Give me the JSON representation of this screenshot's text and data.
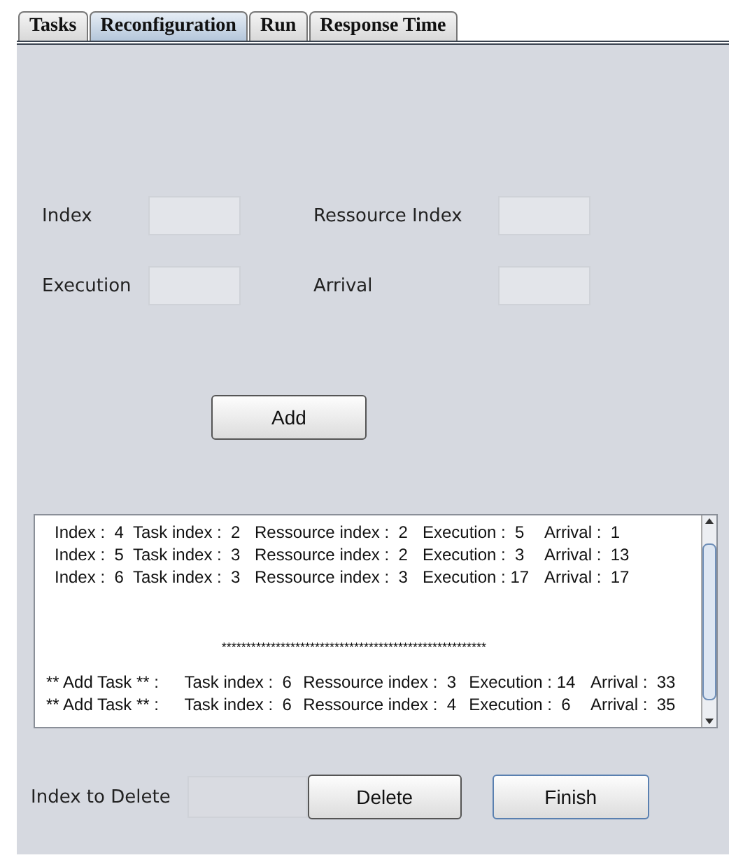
{
  "tabs": [
    {
      "label": "Tasks",
      "selected": false
    },
    {
      "label": "Reconfiguration",
      "selected": true
    },
    {
      "label": "Run",
      "selected": false
    },
    {
      "label": "Response Time",
      "selected": false
    }
  ],
  "form": {
    "fields": [
      {
        "label": "Index"
      },
      {
        "label": "Ressource Index"
      },
      {
        "label": "Execution"
      },
      {
        "label": "Arrival"
      }
    ],
    "add_button": "Add"
  },
  "log": [
    {
      "kind": "entry",
      "parts": [
        "Index :  4",
        "Task index :  2",
        "Ressource index :  2",
        "Execution :  5",
        "Arrival :  1"
      ]
    },
    {
      "kind": "entry",
      "parts": [
        "Index :  5",
        "Task index :  3",
        "Ressource index :  2",
        "Execution :  3",
        "Arrival :  13"
      ]
    },
    {
      "kind": "entry",
      "parts": [
        "Index :  6",
        "Task index :  3",
        "Ressource index :  3",
        "Execution : 17",
        "Arrival :  17"
      ]
    },
    {
      "kind": "separator",
      "parts": [
        "******************************************************"
      ]
    },
    {
      "kind": "add",
      "parts": [
        "** Add Task ** :",
        "Task index :  6",
        "Ressource index :  3",
        "Execution : 14",
        "Arrival :  33"
      ]
    },
    {
      "kind": "add",
      "parts": [
        "** Add Task ** :",
        "Task index :  6",
        "Ressource index :  4",
        "Execution :  6",
        "Arrival :  35"
      ]
    }
  ],
  "delete": {
    "label": "Index to Delete",
    "delete_button": "Delete",
    "finish_button": "Finish"
  }
}
